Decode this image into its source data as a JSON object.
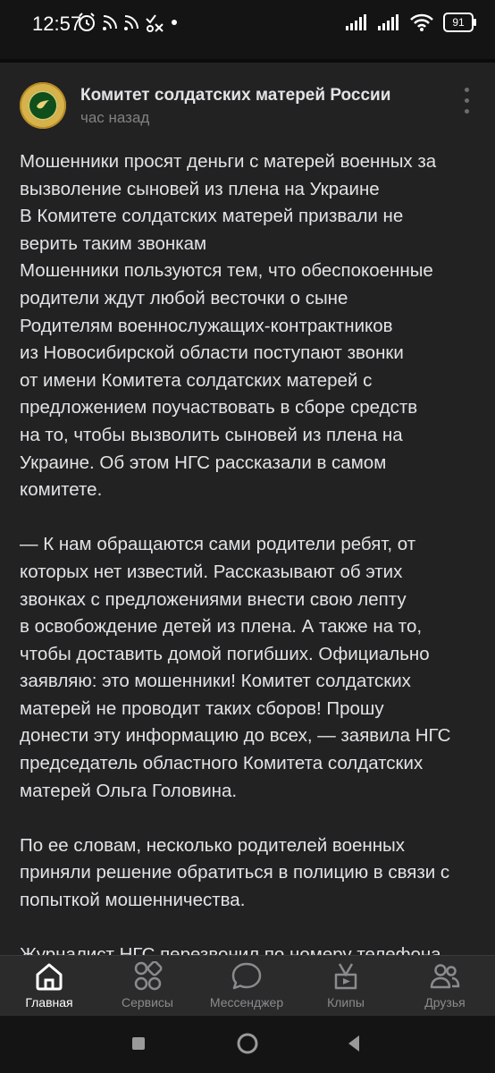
{
  "status_bar": {
    "time": "12:57",
    "battery": "91"
  },
  "post": {
    "author": "Комитет солдатских матерей России",
    "timestamp": "час назад",
    "paragraphs": [
      [
        "Мошенники просят деньги с матерей военных за",
        "вызволение сыновей из плена на Украине",
        "В Комитете солдатских матерей призвали не",
        "верить таким звонкам",
        "Мошенники пользуются тем, что обеспокоенные",
        "родители ждут любой весточки о сыне",
        "Родителям военнослужащих-контрактников",
        "из Новосибирской области поступают звонки",
        "от имени Комитета солдатских матерей с",
        "предложением поучаствовать в сборе средств",
        "на то, чтобы вызволить сыновей из плена на",
        "Украине. Об этом НГС рассказали в самом",
        "комитете."
      ],
      [
        "— К нам обращаются сами родители ребят, от",
        "которых нет известий. Рассказывают об этих",
        "звонках с предложениями внести свою лепту",
        "в освобождение детей из плена. А также на то,",
        "чтобы доставить домой погибших. Официально",
        "заявляю: это мошенники! Комитет солдатских",
        "матерей не проводит таких сборов! Прошу",
        "донести эту информацию до всех, — заявила НГС",
        "председатель областного Комитета солдатских",
        "матерей Ольга Головина."
      ],
      [
        "По ее словам, несколько родителей военных",
        "приняли решение обратиться в полицию в связи с",
        "попыткой мошенничества."
      ],
      [
        "Журналист НГС перезвонил по номеру телефона,"
      ]
    ]
  },
  "bottom_nav": {
    "items": [
      {
        "label": "Главная",
        "icon": "home-icon",
        "active": true
      },
      {
        "label": "Сервисы",
        "icon": "services-icon",
        "active": false
      },
      {
        "label": "Мессенджер",
        "icon": "messenger-icon",
        "active": false
      },
      {
        "label": "Клипы",
        "icon": "clips-icon",
        "active": false
      },
      {
        "label": "Друзья",
        "icon": "friends-icon",
        "active": false
      }
    ]
  },
  "system_nav": [
    "recents-button",
    "home-button",
    "back-button"
  ],
  "colors": {
    "background": "#141414",
    "card": "#222222",
    "text": "#e1e3e6",
    "muted": "#808183",
    "nav_bar": "#2b2b2b"
  }
}
